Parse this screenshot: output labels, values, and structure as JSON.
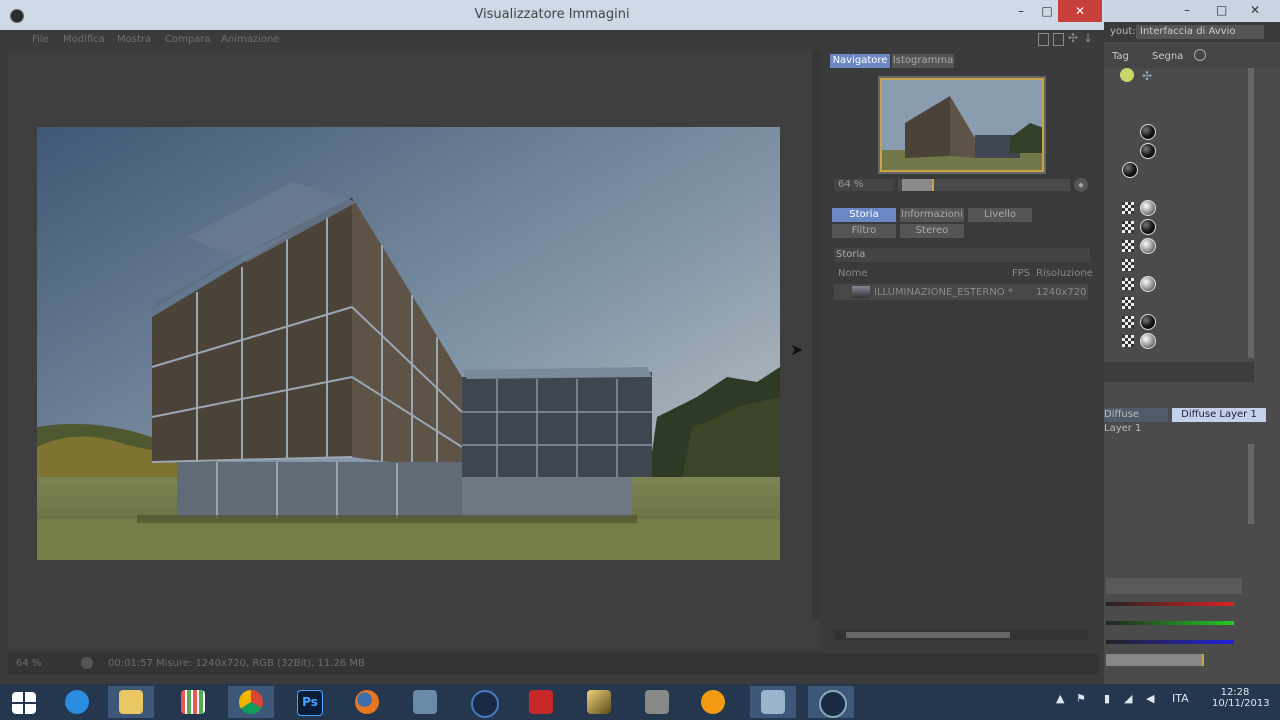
{
  "window": {
    "title": "Visualizzatore Immagini",
    "controls": {
      "minimize": "–",
      "maximize": "□",
      "close": "✕"
    },
    "menu": [
      "File",
      "Modifica",
      "Mostra",
      "Compara",
      "Animazione"
    ]
  },
  "navigator": {
    "tabs": [
      "Navigatore",
      "Istogramma"
    ],
    "zoom_value": "64 %",
    "zoom_stepper": "◆"
  },
  "history": {
    "tabs_row1": [
      "Storia",
      "Informazioni",
      "Livello"
    ],
    "tabs_row2": [
      "Filtro",
      "Stereo"
    ],
    "section_title": "Storia",
    "columns": [
      "Nome",
      "FPS",
      "Risoluzione"
    ],
    "rows": [
      {
        "name": "ILLUMINAZIONE_ESTERNO *",
        "fps": "",
        "resolution": "1240x720"
      }
    ]
  },
  "status": {
    "zoom": "64 %",
    "time": "00:01:57",
    "info": "Misure: 1240x720, RGB (32Bit), 11.26 MB"
  },
  "right_app": {
    "layout_label": "yout:",
    "layout_value": "Interfaccia di Avvio",
    "tabs": [
      "Tag",
      "Segna"
    ],
    "layer_tabs": [
      "Diffuse Layer 1",
      "Diffuse Layer 1"
    ]
  },
  "taskbar": {
    "apps": [
      "start-icon",
      "internet-explorer-icon",
      "file-explorer-icon",
      "apps-grid-icon",
      "chrome-icon",
      "photoshop-icon",
      "firefox-icon",
      "tool-icon",
      "cinema4d-icon",
      "autocad-icon",
      "archicad-icon",
      "render-icon",
      "media-player-icon",
      "desktop-icon",
      "cinema4d-alt-icon"
    ],
    "photoshop_label": "Ps",
    "language": "ITA",
    "time": "12:28",
    "date": "10/11/2013"
  }
}
